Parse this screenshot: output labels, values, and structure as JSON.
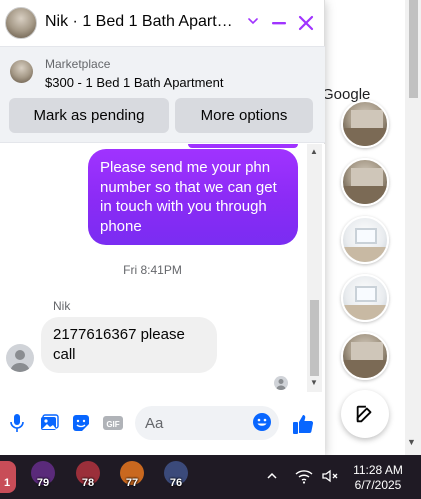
{
  "background": {
    "partial_text": "Google"
  },
  "chat": {
    "title": "Nik · 1 Bed 1 Bath Apartment",
    "marketplace_label": "Marketplace",
    "listing_title": "$300 - 1 Bed 1 Bath Apartment",
    "mark_pending_label": "Mark as pending",
    "more_options_label": "More options",
    "messages": {
      "outgoing": "Please send me your phn number so that we can get in touch with you through phone",
      "timestamp": "Fri 8:41PM",
      "sender_name": "Nik",
      "incoming": "2177616367 please call"
    },
    "composer": {
      "placeholder": "Aa"
    }
  },
  "taskbar": {
    "edge_badge": "1",
    "apps": [
      {
        "badge": "79",
        "color": "#5a2a7a"
      },
      {
        "badge": "78",
        "color": "#9b2f3a"
      },
      {
        "badge": "77",
        "color": "#c9681f"
      },
      {
        "badge": "76",
        "color": "#3b4a7a"
      }
    ],
    "time": "11:28 AM",
    "date": "6/7/2025"
  },
  "colors": {
    "accent": "#a033ff",
    "messenger_blue": "#0866ff",
    "close_purple": "#a033ff"
  }
}
